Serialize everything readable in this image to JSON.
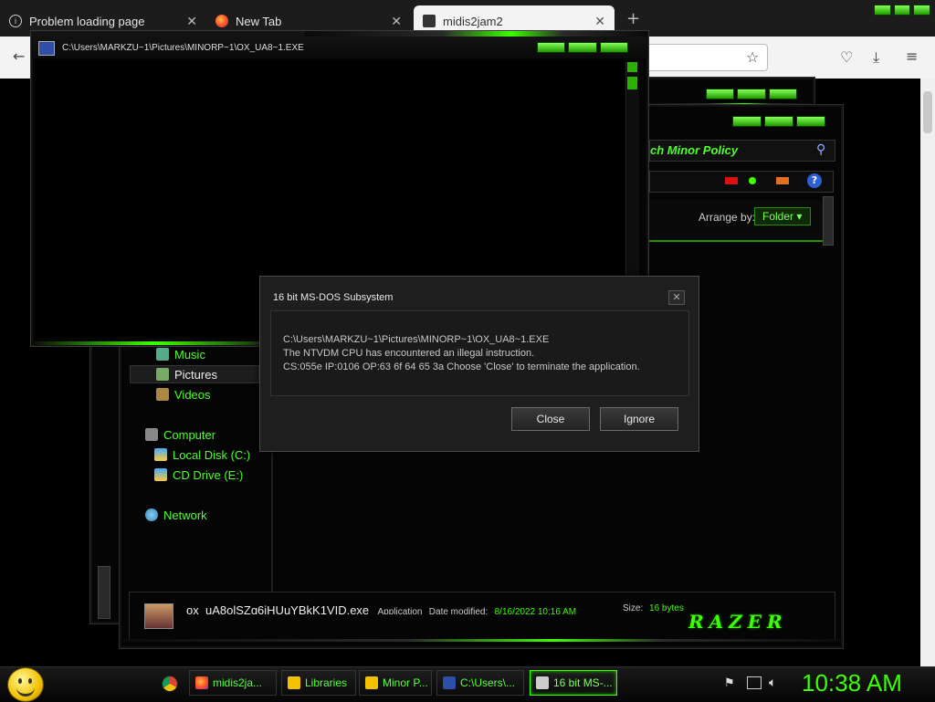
{
  "browser": {
    "tabs": [
      {
        "label": "Problem loading page",
        "icon": "info-icon"
      },
      {
        "label": "New Tab",
        "icon": "firefox-icon"
      },
      {
        "label": "midis2jam2",
        "icon": "midis2jam2-icon"
      }
    ],
    "new_tab_symbol": "+",
    "close_symbol": "✕"
  },
  "console": {
    "title": "C:\\Users\\MARKZU~1\\Pictures\\MINORP~1\\OX_UA8~1.EXE"
  },
  "explorer": {
    "search_text": "ch Minor Policy",
    "arrange_label": "Arrange by:",
    "arrange_value": "Folder",
    "nav": {
      "music": "Music",
      "pictures": "Pictures",
      "videos": "Videos",
      "computer": "Computer",
      "local_disk": "Local Disk (C:)",
      "cd_drive": "CD Drive (E:)",
      "network": "Network"
    },
    "details": {
      "file_name": "ox_uA8olSZq6iHUuYBkK1VID.exe",
      "type": "Application",
      "date_label": "Date modified:",
      "date_value": "8/16/2022 10:16 AM",
      "size_label": "Size:",
      "size_value": "16 bytes"
    },
    "brand_logo": "RAZER"
  },
  "dialog": {
    "title": "16 bit MS-DOS Subsystem",
    "line1": "C:\\Users\\MARKZU~1\\Pictures\\MINORP~1\\OX_UA8~1.EXE",
    "line2": "The NTVDM CPU has encountered an illegal instruction.",
    "line3": "CS:055e IP:0106 OP:63 6f 64 65 3a Choose 'Close' to terminate the application.",
    "close_label": "Close",
    "ignore_label": "Ignore"
  },
  "taskbar": {
    "items": [
      {
        "label": "midis2ja...",
        "icon": "firefox-icon"
      },
      {
        "label": "Libraries",
        "icon": "folder-icon"
      },
      {
        "label": "Minor P...",
        "icon": "folder-icon"
      },
      {
        "label": "C:\\Users\\...",
        "icon": "console-icon"
      },
      {
        "label": "16 bit MS-...",
        "icon": "dialog-icon"
      }
    ],
    "clock": "10:38 AM"
  },
  "colors": {
    "accent_green": "#3dff00",
    "text_green": "#4eff2c"
  }
}
